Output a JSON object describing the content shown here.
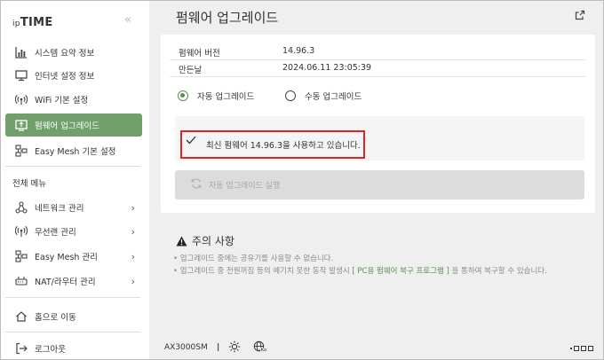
{
  "logo": {
    "prefix": "ip",
    "brand": "TIME"
  },
  "sidebar": {
    "collapse_glyph": "«",
    "top_items": [
      {
        "label": "시스템 요약 정보",
        "icon": "bar-chart-icon"
      },
      {
        "label": "인터넷 설정 정보",
        "icon": "monitor-icon"
      },
      {
        "label": "WiFi 기본 설정",
        "icon": "wifi-icon"
      },
      {
        "label": "펌웨어 업그레이드",
        "icon": "firmware-icon",
        "active": true
      },
      {
        "label": "Easy Mesh 기본 설정",
        "icon": "mesh-icon"
      }
    ],
    "section_label": "전체 메뉴",
    "menu_items": [
      {
        "label": "네트워크 관리",
        "icon": "network-icon"
      },
      {
        "label": "무선랜 관리",
        "icon": "wireless-icon"
      },
      {
        "label": "Easy Mesh 관리",
        "icon": "mesh-icon"
      },
      {
        "label": "NAT/라우터 관리",
        "icon": "router-icon"
      }
    ],
    "home_label": "홈으로 이동",
    "logout_label": "로그아웃"
  },
  "main": {
    "title": "펌웨어 업그레이드",
    "firmware_version_label": "펌웨어 버전",
    "firmware_version_value": "14.96.3",
    "build_date_label": "만든날",
    "build_date_value": "2024.06.11 23:05:39",
    "radio_auto": "자동 업그레이드",
    "radio_manual": "수동 업그레이드",
    "selected_mode": "auto",
    "status_text": "최신 펌웨어 14.96.3을 사용하고 있습니다.",
    "run_button": "자동 업그레이드 실행",
    "notice_title": "주의 사항",
    "notice_1": "• 업그레이드 중에는 공유기를 사용할 수 없습니다.",
    "notice_2_pre": "• 업그레이드 중 전원꺼짐 등의 예기치 못한 동작 발생시 ",
    "notice_2_link": "[ PC용 펌웨어 복구 프로그램 ]",
    "notice_2_post": " 을 통하여 복구할 수 있습니다."
  },
  "footer": {
    "model": "AX3000SM",
    "separator": "|",
    "lang_badge": "Ko"
  },
  "colors": {
    "accent": "#71a06c",
    "highlight_border": "#e0251f",
    "main_bg": "#efefef"
  }
}
